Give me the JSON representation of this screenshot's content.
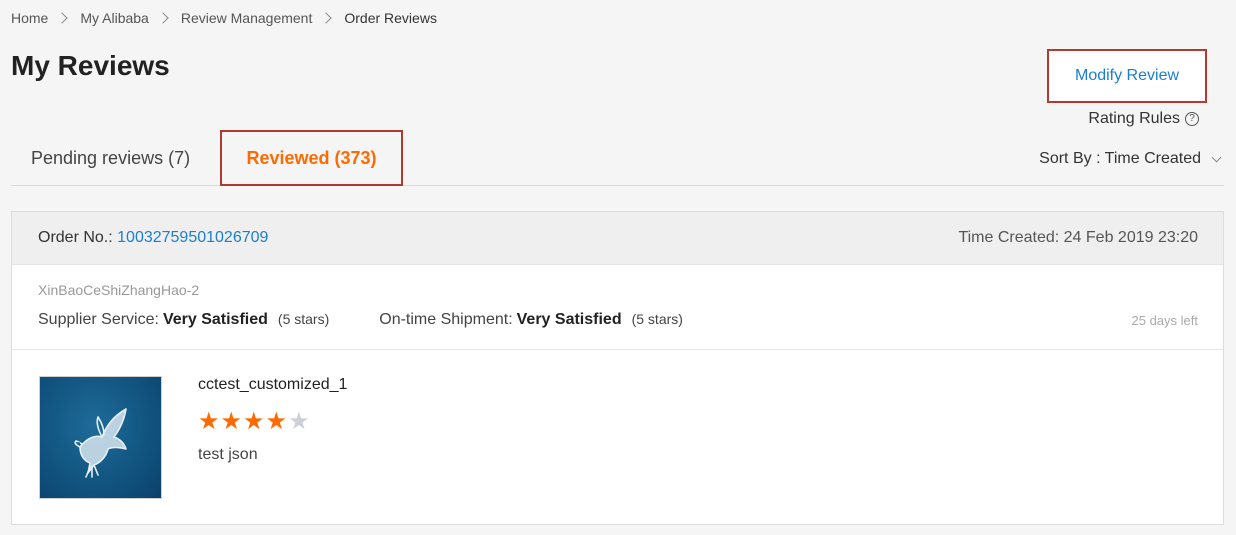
{
  "breadcrumb": [
    "Home",
    "My Alibaba",
    "Review Management",
    "Order Reviews"
  ],
  "page_title": "My Reviews",
  "rating_rules": "Rating Rules",
  "tabs": {
    "pending": "Pending reviews (7)",
    "reviewed": "Reviewed (373)"
  },
  "sort_by": "Sort By : Time Created",
  "order": {
    "label": "Order No.:",
    "number": "10032759501026709",
    "time_created": "Time Created: 24 Feb 2019 23:20",
    "supplier_name": "XinBaoCeShiZhangHao-2",
    "supplier_service_label": "Supplier Service:",
    "supplier_service_value": "Very Satisfied",
    "supplier_service_stars": "(5 stars)",
    "shipment_label": "On-time Shipment:",
    "shipment_value": "Very Satisfied",
    "shipment_stars": "(5 stars)",
    "modify_review": "Modify Review",
    "days_left": "25 days left"
  },
  "product": {
    "name": "cctest_customized_1",
    "rating": 4,
    "max_rating": 5,
    "review": "test json",
    "thumbnail_icon": "white-dove-on-blue"
  },
  "colors": {
    "accent_orange": "#ff6a00",
    "link_blue": "#1a7ed1",
    "highlight_border": "#b03a2e"
  }
}
